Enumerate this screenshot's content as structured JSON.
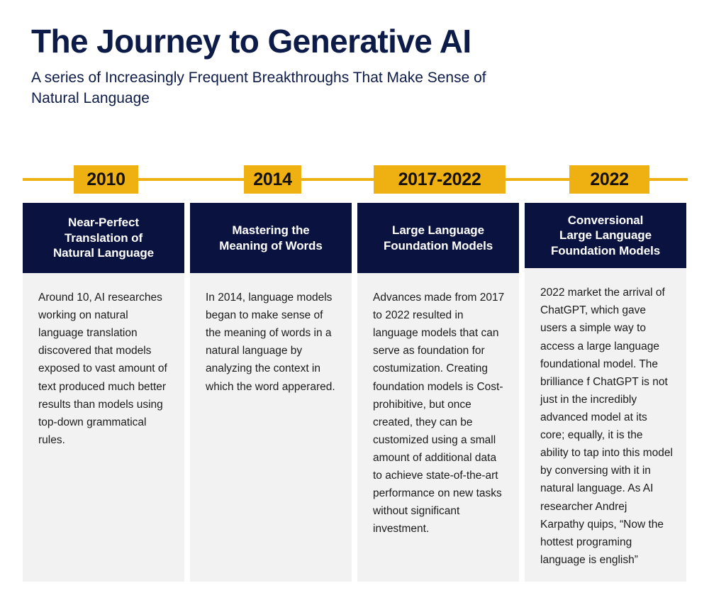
{
  "header": {
    "title": "The Journey to Generative AI",
    "subtitle": "A series of Increasingly Frequent Breakthroughs That Make Sense of Natural Language"
  },
  "colors": {
    "accent_gold": "#eeb111",
    "navy": "#0a1340",
    "card_body": "#f2f2f2",
    "title_navy": "#0d1b48",
    "background": "#ffffff"
  },
  "timeline": {
    "years": [
      {
        "label": "2010"
      },
      {
        "label": "2014"
      },
      {
        "label": "2017-2022"
      },
      {
        "label": "2022"
      }
    ]
  },
  "columns": [
    {
      "year": "2010",
      "heading": "Near-Perfect\nTranslation of\nNatural Language",
      "body": "Around 10, AI researches working on natural language translation discovered that models exposed to vast amount of text produced much better results than models using top-down grammatical rules."
    },
    {
      "year": "2014",
      "heading": "Mastering the\nMeaning of Words",
      "body": "In 2014, language models began to make sense of the meaning of words in a natural language by analyzing the context in which the word apperared."
    },
    {
      "year": "2017-2022",
      "heading": "Large Language\nFoundation Models",
      "body": "Advances made from 2017 to 2022 resulted in language models that can serve as foundation for costumization. Creating foundation models is Cost-prohibitive, but once created, they can be customized using a small amount of additional data to achieve state-of-the-art performance on new tasks without significant investment."
    },
    {
      "year": "2022",
      "heading": "Conversional\nLarge Language\nFoundation Models",
      "body": "2022 market the arrival of ChatGPT, which gave users a simple way to access a large language foundational model. The brilliance f ChatGPT is not just in the incredibly advanced model at its core; equally, it is the ability to tap into this model by conversing with it in natural language. As AI researcher Andrej Karpathy quips, “Now the hottest programing language is english”"
    }
  ]
}
